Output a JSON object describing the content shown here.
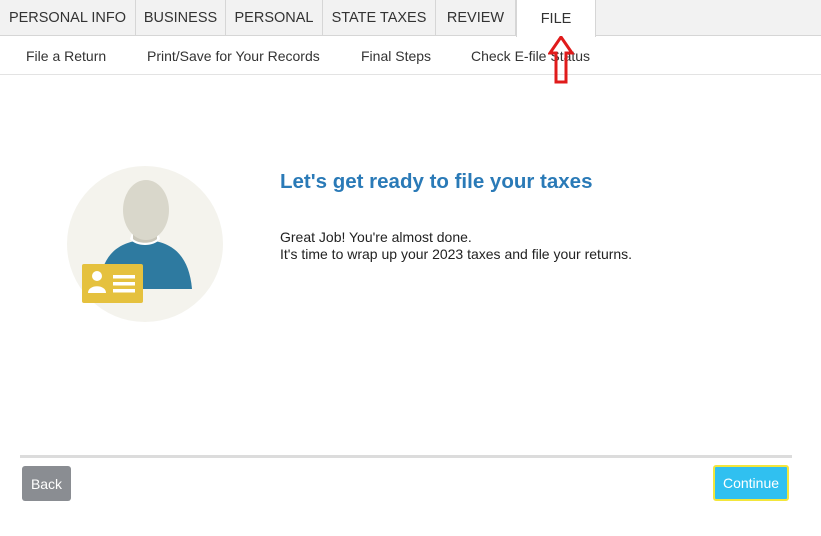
{
  "top_tabs": [
    {
      "label": "PERSONAL INFO"
    },
    {
      "label": "BUSINESS"
    },
    {
      "label": "PERSONAL"
    },
    {
      "label": "STATE TAXES"
    },
    {
      "label": "REVIEW"
    },
    {
      "label": "FILE",
      "active": true
    }
  ],
  "sub_nav": [
    {
      "label": "File a Return"
    },
    {
      "label": "Print/Save for Your Records"
    },
    {
      "label": "Final Steps"
    },
    {
      "label": "Check E-file Status"
    }
  ],
  "main": {
    "heading": "Let's get ready to file your taxes",
    "line1": "Great Job! You're almost done.",
    "line2": "It's time to wrap up your 2023 taxes and file your returns.",
    "illustration_icon": "person-id-card-icon"
  },
  "footer": {
    "back_label": "Back",
    "continue_label": "Continue"
  },
  "colors": {
    "accent_blue": "#2a7ab7",
    "continue_bg": "#30c0f0",
    "continue_border": "#f3e63b",
    "back_bg": "#8a8d92",
    "arrow_red": "#e01b1b"
  }
}
